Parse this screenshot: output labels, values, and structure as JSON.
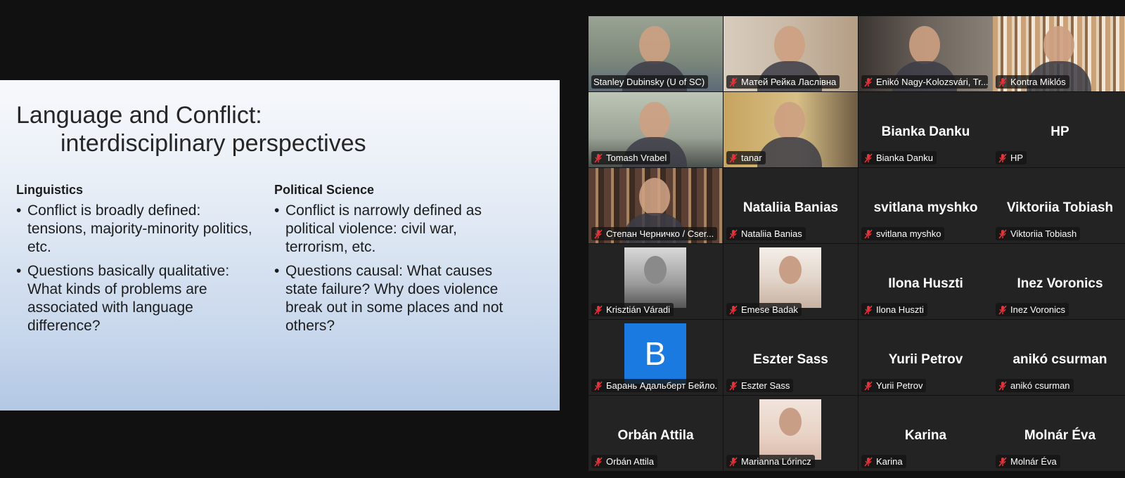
{
  "slide": {
    "title": "Language and Conflict:",
    "subtitle": "interdisciplinary perspectives",
    "columns": [
      {
        "heading": "Linguistics",
        "bullets": [
          "Conflict is broadly defined: tensions, majority-minority politics, etc.",
          "Questions basically qualitative: What kinds of problems are associated with language difference?"
        ]
      },
      {
        "heading": "Political Science",
        "bullets": [
          "Conflict is narrowly defined as political violence: civil war, terrorism, etc.",
          "Questions causal: What causes state failure? Why does violence break out in some places and not others?"
        ]
      }
    ]
  },
  "participants": [
    {
      "label": "Stanley Dubinsky (U of SC)",
      "name": "",
      "mic_muted": false,
      "type": "video",
      "active": true
    },
    {
      "label": "Матей Рейка Ласлівна",
      "name": "",
      "mic_muted": true,
      "type": "video"
    },
    {
      "label": "Enikó Nagy-Kolozsvári, Tr...",
      "name": "",
      "mic_muted": true,
      "type": "video"
    },
    {
      "label": "Kontra Miklós",
      "name": "",
      "mic_muted": true,
      "type": "video"
    },
    {
      "label": "Tomash Vrabel",
      "name": "",
      "mic_muted": true,
      "type": "video"
    },
    {
      "label": "tanar",
      "name": "",
      "mic_muted": true,
      "type": "video"
    },
    {
      "label": "Bianka Danku",
      "name": "Bianka Danku",
      "mic_muted": true,
      "type": "name"
    },
    {
      "label": "HP",
      "name": "HP",
      "mic_muted": true,
      "type": "name"
    },
    {
      "label": "Степан Черничко / Cser...",
      "name": "",
      "mic_muted": true,
      "type": "video"
    },
    {
      "label": "Nataliia Banias",
      "name": "Nataliia Banias",
      "mic_muted": true,
      "type": "name"
    },
    {
      "label": "svitlana myshko",
      "name": "svitlana myshko",
      "mic_muted": true,
      "type": "name"
    },
    {
      "label": "Viktoriia Tobiash",
      "name": "Viktoriia Tobiash",
      "mic_muted": true,
      "type": "name"
    },
    {
      "label": "Krisztián Váradi",
      "name": "",
      "mic_muted": true,
      "type": "photo"
    },
    {
      "label": "Emese Badak",
      "name": "",
      "mic_muted": true,
      "type": "photo"
    },
    {
      "label": "Ilona Huszti",
      "name": "Ilona Huszti",
      "mic_muted": true,
      "type": "name"
    },
    {
      "label": "Inez Voronics",
      "name": "Inez Voronics",
      "mic_muted": true,
      "type": "name"
    },
    {
      "label": "Барань Адальберт Бейло...",
      "name": "",
      "mic_muted": true,
      "type": "letter",
      "letter": "B"
    },
    {
      "label": "Eszter Sass",
      "name": "Eszter Sass",
      "mic_muted": true,
      "type": "name"
    },
    {
      "label": "Yurii Petrov",
      "name": "Yurii Petrov",
      "mic_muted": true,
      "type": "name"
    },
    {
      "label": "anikó csurman",
      "name": "anikó csurman",
      "mic_muted": true,
      "type": "name"
    },
    {
      "label": "Orbán Attila",
      "name": "Orbán Attila",
      "mic_muted": true,
      "type": "name"
    },
    {
      "label": "Marianna Lórincz",
      "name": "",
      "mic_muted": true,
      "type": "photo"
    },
    {
      "label": "Karina",
      "name": "Karina",
      "mic_muted": true,
      "type": "name"
    },
    {
      "label": "Molnár Éva",
      "name": "Molnár Éva",
      "mic_muted": true,
      "type": "name"
    }
  ],
  "colors": {
    "active_speaker": "#3ee06a",
    "muted_icon": "#e0353b",
    "tile_bg": "#232323",
    "avatar_blue": "#1a7ae0"
  },
  "icons": {
    "muted": "mic-muted-icon"
  }
}
